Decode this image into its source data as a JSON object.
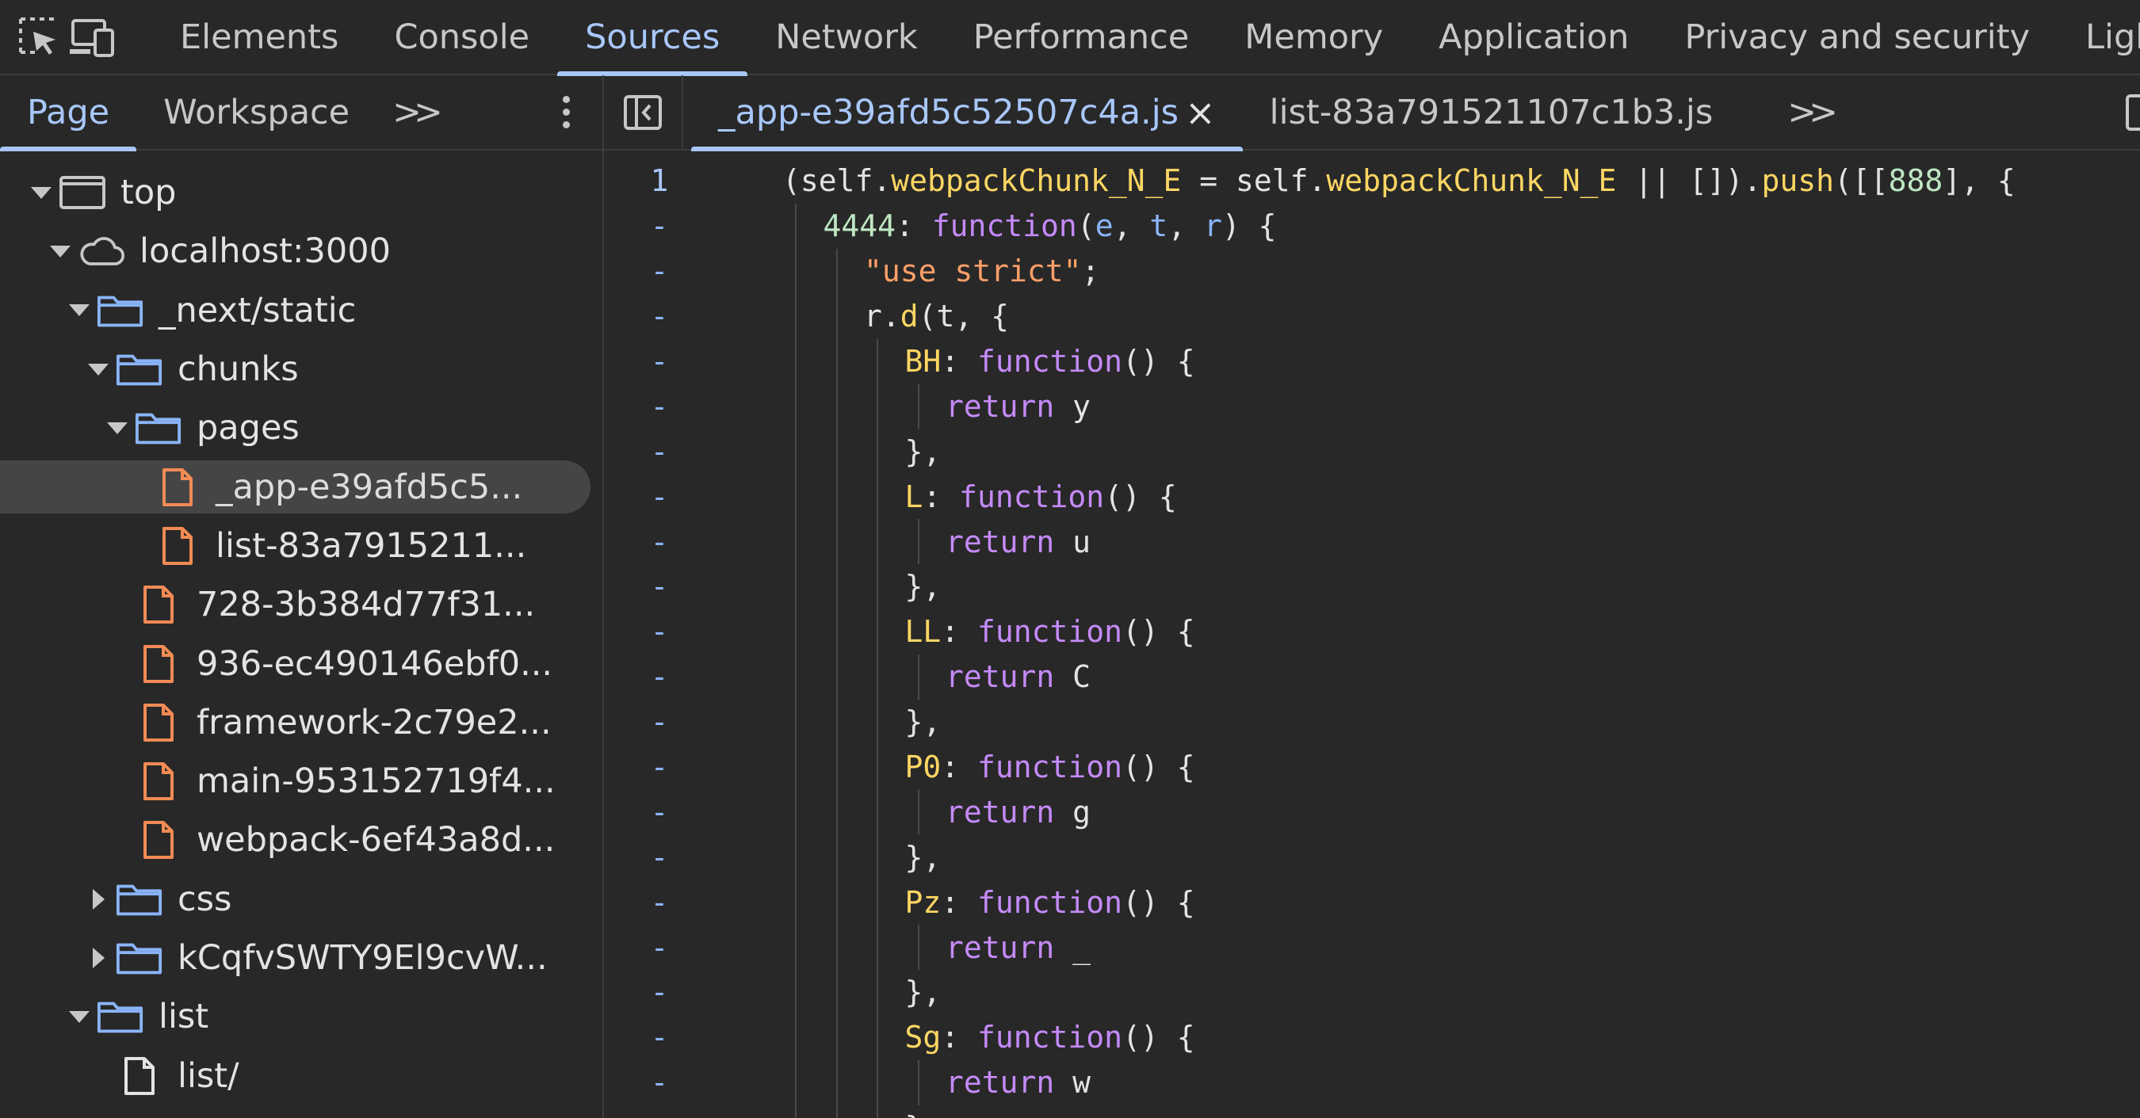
{
  "top_tabs": [
    "Elements",
    "Console",
    "Sources",
    "Network",
    "Performance",
    "Memory",
    "Application",
    "Privacy and security",
    "Lighthouse"
  ],
  "active_top_tab": "Sources",
  "navigator": {
    "tabs": [
      "Page",
      "Workspace"
    ],
    "more_label": ">>",
    "tree": [
      {
        "label": "top",
        "depth": 0,
        "arrow": "down",
        "icon": "frame-icon"
      },
      {
        "label": "localhost:3000",
        "depth": 1,
        "arrow": "down",
        "icon": "cloud-icon"
      },
      {
        "label": "_next/static",
        "depth": 2,
        "arrow": "down",
        "icon": "folder-icon"
      },
      {
        "label": "chunks",
        "depth": 3,
        "arrow": "down",
        "icon": "folder-icon"
      },
      {
        "label": "pages",
        "depth": 4,
        "arrow": "down",
        "icon": "folder-icon"
      },
      {
        "label": "_app-e39afd5c5...",
        "depth": 5,
        "arrow": "none",
        "icon": "js-file-icon",
        "selected": true
      },
      {
        "label": "list-83a7915211...",
        "depth": 5,
        "arrow": "none",
        "icon": "js-file-icon"
      },
      {
        "label": "728-3b384d77f31...",
        "depth": 4,
        "arrow": "none",
        "icon": "js-file-icon"
      },
      {
        "label": "936-ec490146ebf0...",
        "depth": 4,
        "arrow": "none",
        "icon": "js-file-icon"
      },
      {
        "label": "framework-2c79e2...",
        "depth": 4,
        "arrow": "none",
        "icon": "js-file-icon"
      },
      {
        "label": "main-953152719f4...",
        "depth": 4,
        "arrow": "none",
        "icon": "js-file-icon"
      },
      {
        "label": "webpack-6ef43a8d...",
        "depth": 4,
        "arrow": "none",
        "icon": "js-file-icon"
      },
      {
        "label": "css",
        "depth": 3,
        "arrow": "right",
        "icon": "folder-icon"
      },
      {
        "label": "kCqfvSWTY9El9cvW...",
        "depth": 3,
        "arrow": "right",
        "icon": "folder-icon"
      },
      {
        "label": "list",
        "depth": 2,
        "arrow": "down",
        "icon": "folder-icon"
      },
      {
        "label": "list/",
        "depth": 3,
        "arrow": "none",
        "icon": "document-icon"
      }
    ]
  },
  "editor": {
    "tabs": [
      {
        "label": "_app-e39afd5c52507c4a.js",
        "active": true,
        "closable": true
      },
      {
        "label": "list-83a791521107c1b3.js",
        "active": false,
        "closable": false
      }
    ],
    "more_label": ">>",
    "lines": [
      {
        "num": "1",
        "indent": 0,
        "tokens": [
          [
            "(",
            "t-id"
          ],
          [
            "self",
            "t-id"
          ],
          [
            ".",
            "t-id"
          ],
          [
            "webpackChunk_N_E",
            "t-prop"
          ],
          [
            " = ",
            "t-id"
          ],
          [
            "self",
            "t-id"
          ],
          [
            ".",
            "t-id"
          ],
          [
            "webpackChunk_N_E",
            "t-prop"
          ],
          [
            " || []).",
            "t-id"
          ],
          [
            "push",
            "t-prop"
          ],
          [
            "([[",
            "t-id"
          ],
          [
            "888",
            "t-num"
          ],
          [
            "], {",
            "t-id"
          ]
        ]
      },
      {
        "num": "-",
        "indent": 1,
        "tokens": [
          [
            "4444",
            "t-num"
          ],
          [
            ": ",
            "t-id"
          ],
          [
            "function",
            "t-fn"
          ],
          [
            "(",
            "t-id"
          ],
          [
            "e",
            "t-par"
          ],
          [
            ", ",
            "t-id"
          ],
          [
            "t",
            "t-par"
          ],
          [
            ", ",
            "t-id"
          ],
          [
            "r",
            "t-par"
          ],
          [
            ") {",
            "t-id"
          ]
        ]
      },
      {
        "num": "-",
        "indent": 2,
        "tokens": [
          [
            "\"use strict\"",
            "t-str"
          ],
          [
            ";",
            "t-id"
          ]
        ]
      },
      {
        "num": "-",
        "indent": 2,
        "tokens": [
          [
            "r",
            "t-id"
          ],
          [
            ".",
            "t-id"
          ],
          [
            "d",
            "t-prop"
          ],
          [
            "(t, {",
            "t-id"
          ]
        ]
      },
      {
        "num": "-",
        "indent": 3,
        "tokens": [
          [
            "BH",
            "t-key"
          ],
          [
            ": ",
            "t-id"
          ],
          [
            "function",
            "t-fn"
          ],
          [
            "() {",
            "t-id"
          ]
        ]
      },
      {
        "num": "-",
        "indent": 4,
        "tokens": [
          [
            "return",
            "t-kw"
          ],
          [
            " y",
            "t-id"
          ]
        ]
      },
      {
        "num": "-",
        "indent": 3,
        "tokens": [
          [
            "},",
            "t-id"
          ]
        ]
      },
      {
        "num": "-",
        "indent": 3,
        "tokens": [
          [
            "L",
            "t-key"
          ],
          [
            ": ",
            "t-id"
          ],
          [
            "function",
            "t-fn"
          ],
          [
            "() {",
            "t-id"
          ]
        ]
      },
      {
        "num": "-",
        "indent": 4,
        "tokens": [
          [
            "return",
            "t-kw"
          ],
          [
            " u",
            "t-id"
          ]
        ]
      },
      {
        "num": "-",
        "indent": 3,
        "tokens": [
          [
            "},",
            "t-id"
          ]
        ]
      },
      {
        "num": "-",
        "indent": 3,
        "tokens": [
          [
            "LL",
            "t-key"
          ],
          [
            ": ",
            "t-id"
          ],
          [
            "function",
            "t-fn"
          ],
          [
            "() {",
            "t-id"
          ]
        ]
      },
      {
        "num": "-",
        "indent": 4,
        "tokens": [
          [
            "return",
            "t-kw"
          ],
          [
            " C",
            "t-id"
          ]
        ]
      },
      {
        "num": "-",
        "indent": 3,
        "tokens": [
          [
            "},",
            "t-id"
          ]
        ]
      },
      {
        "num": "-",
        "indent": 3,
        "tokens": [
          [
            "P0",
            "t-key"
          ],
          [
            ": ",
            "t-id"
          ],
          [
            "function",
            "t-fn"
          ],
          [
            "() {",
            "t-id"
          ]
        ]
      },
      {
        "num": "-",
        "indent": 4,
        "tokens": [
          [
            "return",
            "t-kw"
          ],
          [
            " g",
            "t-id"
          ]
        ]
      },
      {
        "num": "-",
        "indent": 3,
        "tokens": [
          [
            "},",
            "t-id"
          ]
        ]
      },
      {
        "num": "-",
        "indent": 3,
        "tokens": [
          [
            "Pz",
            "t-key"
          ],
          [
            ": ",
            "t-id"
          ],
          [
            "function",
            "t-fn"
          ],
          [
            "() {",
            "t-id"
          ]
        ]
      },
      {
        "num": "-",
        "indent": 4,
        "tokens": [
          [
            "return",
            "t-kw"
          ],
          [
            " _",
            "t-id"
          ]
        ]
      },
      {
        "num": "-",
        "indent": 3,
        "tokens": [
          [
            "},",
            "t-id"
          ]
        ]
      },
      {
        "num": "-",
        "indent": 3,
        "tokens": [
          [
            "Sg",
            "t-key"
          ],
          [
            ": ",
            "t-id"
          ],
          [
            "function",
            "t-fn"
          ],
          [
            "() {",
            "t-id"
          ]
        ]
      },
      {
        "num": "-",
        "indent": 4,
        "tokens": [
          [
            "return",
            "t-kw"
          ],
          [
            " w",
            "t-id"
          ]
        ]
      },
      {
        "num": "-",
        "indent": 3,
        "tokens": [
          [
            "},",
            "t-id"
          ]
        ]
      }
    ]
  },
  "colors": {
    "accent": "#a8c7fa",
    "background": "#282828",
    "file_icon": "#f28b54",
    "folder_icon": "#8ab4f8"
  }
}
